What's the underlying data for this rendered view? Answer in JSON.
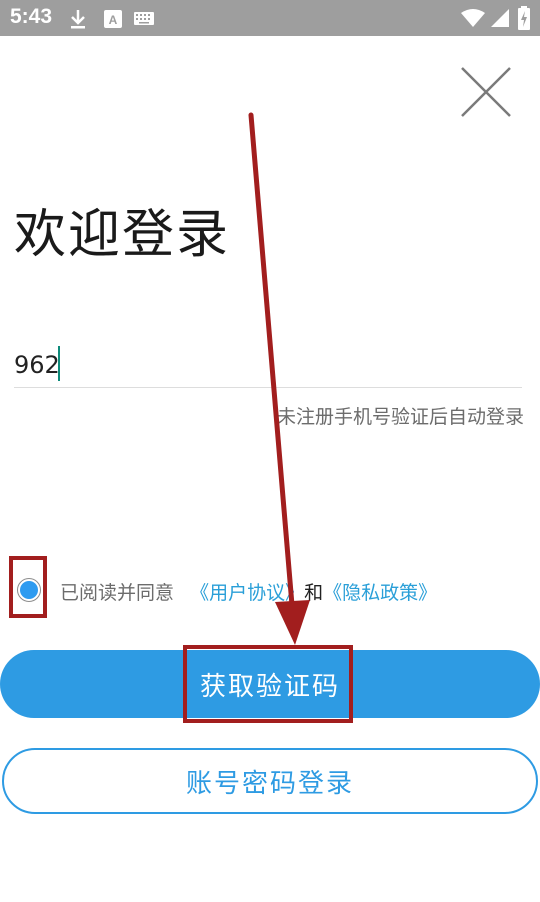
{
  "status_bar": {
    "time": "5:43",
    "icons": [
      "download-icon",
      "text-a-icon",
      "keyboard-icon",
      "wifi-icon",
      "signal-icon",
      "battery-charging-icon"
    ]
  },
  "login": {
    "title": "欢迎登录",
    "phone_value": "962",
    "hint": "未注册手机号验证后自动登录",
    "agreement": {
      "prefix": "已阅读并同意",
      "user_agreement": "《用户协议》",
      "and": "和",
      "privacy_policy": "《隐私政策》",
      "checked": true
    },
    "get_code_button": "获取验证码",
    "password_login_button": "账号密码登录"
  },
  "colors": {
    "primary": "#2e9be3",
    "link": "#2a9fd8",
    "annotation": "#a21e1e",
    "status_bar": "#9e9e9e"
  }
}
